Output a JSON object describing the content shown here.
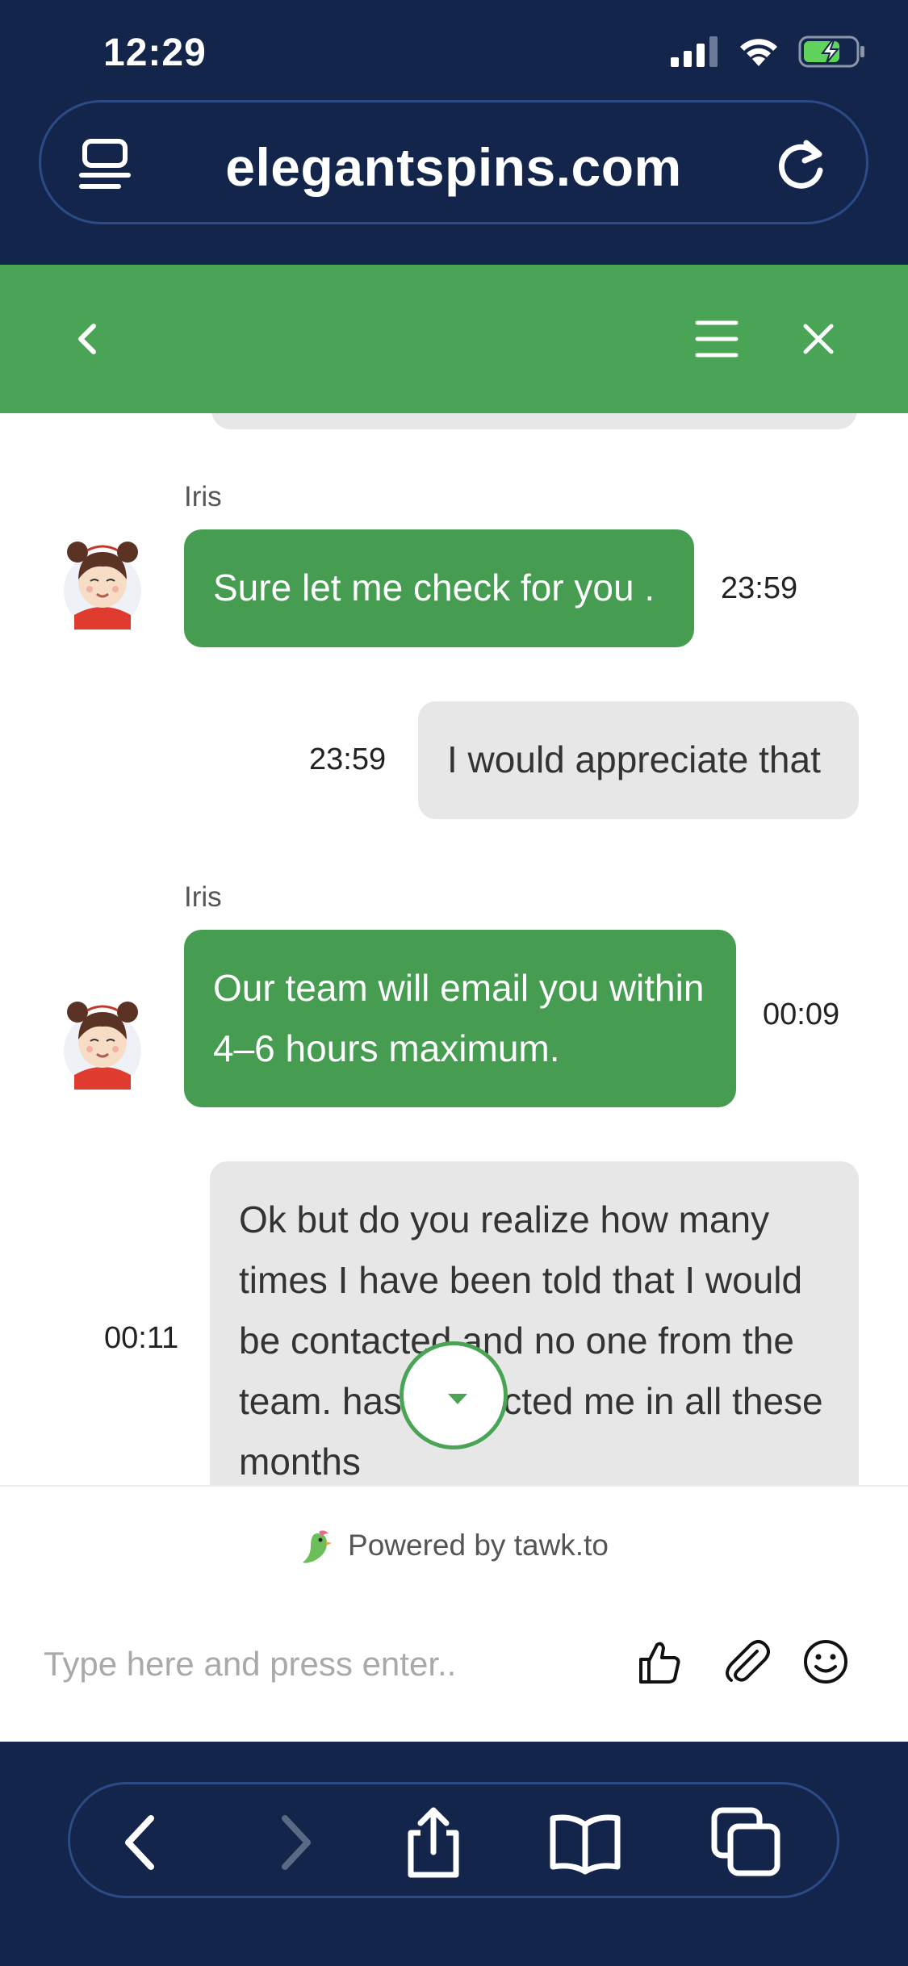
{
  "status_bar": {
    "time": "12:29"
  },
  "browser": {
    "url": "elegantspins.com"
  },
  "colors": {
    "brand_green": "#4aa456",
    "bubble_green": "#469c51",
    "browser_navy": "#13254a"
  },
  "messages": [
    {
      "sender": "agent",
      "name": "Iris",
      "text": "Sure let me check for you .",
      "time": "23:59"
    },
    {
      "sender": "visitor",
      "text": "I would appreciate that",
      "time": "23:59"
    },
    {
      "sender": "agent",
      "name": "Iris",
      "text": "Our team will email you within 4–6 hours maximum.",
      "time": "00:09"
    },
    {
      "sender": "visitor",
      "text": "Ok but do you realize how many times I have been told that I would be contacted and no one from the team. has contacted me in all these months",
      "time": "00:11"
    }
  ],
  "footer": {
    "powered_by": "Powered by tawk.to",
    "input_placeholder": "Type here and press enter.."
  },
  "icons": {
    "header": [
      "back-icon",
      "menu-icon",
      "close-icon"
    ],
    "footer": [
      "thumbs-up-icon",
      "paperclip-icon",
      "emoji-icon"
    ],
    "toolbar": [
      "back-icon",
      "forward-icon",
      "share-icon",
      "bookmarks-icon",
      "tabs-icon"
    ]
  }
}
